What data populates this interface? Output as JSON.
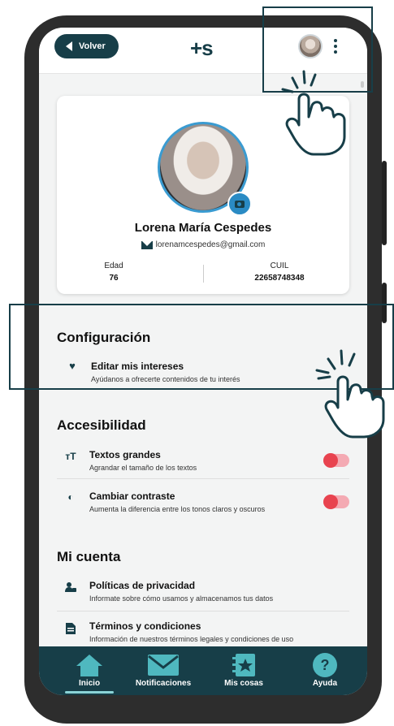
{
  "header": {
    "back_label": "Volver",
    "logo_text": "+s"
  },
  "profile": {
    "name": "Lorena María Cespedes",
    "email": "lorenamcespedes@gmail.com",
    "age_label": "Edad",
    "age_value": "76",
    "cuil_label": "CUIL",
    "cuil_value": "22658748348"
  },
  "config": {
    "title": "Configuración",
    "items": [
      {
        "title": "Editar mis intereses",
        "subtitle": "Ayúdanos a ofrecerte contenidos de tu interés",
        "icon": "heart-icon"
      }
    ]
  },
  "accessibility": {
    "title": "Accesibilidad",
    "items": [
      {
        "title": "Textos grandes",
        "subtitle": "Agrandar el tamaño de los textos",
        "icon": "text-size-icon",
        "glyph": "тT",
        "enabled": false
      },
      {
        "title": "Cambiar contraste",
        "subtitle": "Aumenta la diferencia entre los tonos claros y oscuros",
        "icon": "contrast-icon",
        "glyph": "◐",
        "enabled": false
      }
    ]
  },
  "account": {
    "title": "Mi cuenta",
    "items": [
      {
        "title": "Políticas de privacidad",
        "subtitle": "Informate sobre cómo usamos y almacenamos tus datos",
        "icon": "privacy-icon"
      },
      {
        "title": "Términos y condiciones",
        "subtitle": "Información de nuestros términos legales y condiciones de uso",
        "icon": "document-icon"
      }
    ]
  },
  "nav": {
    "items": [
      {
        "label": "Inicio",
        "icon": "home-icon",
        "active": true
      },
      {
        "label": "Notificaciones",
        "icon": "mail-icon"
      },
      {
        "label": "Mis cosas",
        "icon": "star-book-icon"
      },
      {
        "label": "Ayuda",
        "icon": "help-icon"
      }
    ]
  },
  "colors": {
    "primary": "#173e48",
    "accent": "#3a9bd1",
    "toggle_off": "#e8434f",
    "nav_active": "#8ad3d6"
  }
}
